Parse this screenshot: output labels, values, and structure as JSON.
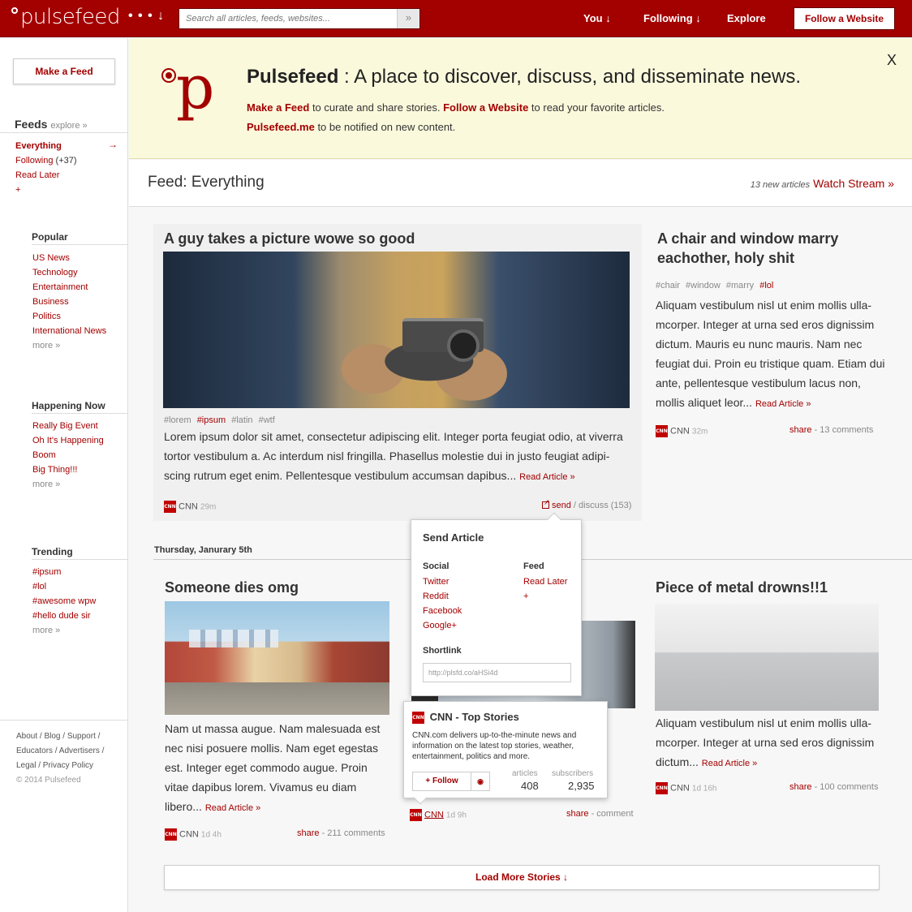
{
  "header": {
    "logo_text": "pulsefeed",
    "dots_label": "• • • ↓",
    "search_placeholder": "Search all articles, feeds, websites...",
    "search_button": "»",
    "nav": [
      "You ↓",
      "Following ↓",
      "Explore"
    ],
    "follow_website": "Follow a Website"
  },
  "sidebar": {
    "make_feed": "Make a Feed",
    "feeds_title": "Feeds",
    "feeds_explore": "explore »",
    "feeds": [
      {
        "label": "Everything"
      },
      {
        "label": "Following",
        "count": "(+37)"
      },
      {
        "label": "Read Later"
      },
      {
        "label": "+"
      }
    ],
    "arrow": "→",
    "popular_title": "Popular",
    "popular": [
      "US News",
      "Technology",
      "Entertainment",
      "Business",
      "Politics",
      "International News",
      "more »"
    ],
    "happening_title": "Happening Now",
    "happening": [
      "Really Big Event",
      "Oh It's Happening",
      "Boom",
      "Big Thing!!!",
      "more »"
    ],
    "trending_title": "Trending",
    "trending": [
      "#ipsum",
      "#lol",
      "#awesome wpw",
      "#hello dude sir",
      "more »"
    ],
    "footer": [
      "About / Blog / Support /",
      "Educators / Advertisers /",
      "Legal / Privacy Policy",
      "© 2014 Pulsefeed"
    ]
  },
  "banner": {
    "brand": "Pulsefeed",
    "tagline": " : A place to discover, discuss, and disseminate news.",
    "line1_a": "Make a Feed",
    "line1_b": " to curate and share stories.  ",
    "line1_c": "Follow a Website",
    "line1_d": " to read your favorite articles.",
    "line2_a": "Pulsefeed.me",
    "line2_b": " to be notified on new content.",
    "close": "X"
  },
  "feed": {
    "title": "Feed: Everything",
    "new_articles": "13 new articles",
    "watch_stream": "Watch Stream »"
  },
  "articles": {
    "featured": {
      "title": "A guy takes a picture wowe so good",
      "tags": [
        "#lorem",
        "#ipsum",
        "#latin",
        "#wtf"
      ],
      "body": "Lorem ipsum dolor sit amet, consectetur adipiscing elit. Integer porta feugiat odio, at viverra tortor vestibulum a. Ac interdum nisl fringilla. Phasellus molestie dui in justo feugiat adipi-scing rutrum eget enim. Pellentesque vestibulum accumsan dapibus... ",
      "read_more": "Read Article »",
      "source": "CNN",
      "time": "29m",
      "send": "send",
      "discuss": " / discuss (153)"
    },
    "chair": {
      "title": "A chair and window marry eachother, holy shit",
      "tags": [
        "#chair",
        "#window",
        "#marry",
        "#lol"
      ],
      "body": "Aliquam vestibulum nisl ut enim mollis ulla-mcorper. Integer at urna sed eros dignissim dictum. Mauris eu nunc mauris. Nam nec feugiat dui. Proin eu tristique quam. Etiam dui ante, pellentesque vestibulum lacus non, mollis aliquet leor... ",
      "read_more": "Read Article »",
      "source": "CNN",
      "time": "32m",
      "share": "share",
      "comments": " - 13 comments"
    },
    "date_label": "Thursday, Janurary 5th",
    "dies": {
      "title": "Someone dies omg",
      "body": "Nam ut massa augue. Nam malesuada est nec nisi posuere mollis. Nam eget egestas est. Integer eget commodo augue. Proin vitae dapibus lorem. Vivamus eu diam libero... ",
      "read_more": "Read Article »",
      "source": "CNN",
      "time": "1d 4h",
      "share": "share",
      "comments": " - 211 comments"
    },
    "middle": {
      "source": "CNN",
      "time": "1d 9h",
      "share": "share",
      "comments": " - comment"
    },
    "metal": {
      "title": "Piece of metal drowns!!1",
      "body": "Aliquam vestibulum nisl ut enim mollis ulla-mcorper. Integer at urna sed eros dignissim dictum... ",
      "read_more": "Read Article »",
      "source": "CNN",
      "time": "1d 16h",
      "share": "share",
      "comments": " - 100 comments"
    },
    "load_more": "Load More Stories ↓"
  },
  "send_popover": {
    "title": "Send Article",
    "social_title": "Social",
    "social": [
      "Twitter",
      "Reddit",
      "Facebook",
      "Google+"
    ],
    "feed_title": "Feed",
    "feed": [
      "Read Later",
      "+"
    ],
    "shortlink_title": "Shortlink",
    "shortlink_value": "http://plsfd.co/aHSi4d"
  },
  "source_card": {
    "name": "CNN - Top Stories",
    "description": "CNN.com delivers up-to-the-minute news and information on the latest top stories, weather, entertainment, politics and more.",
    "follow": "+ Follow",
    "articles_label": "articles",
    "articles_value": "408",
    "subscribers_label": "subscribers",
    "subscribers_value": "2,935"
  },
  "logo_label": "CNN",
  "colors": {
    "brand": "#a30000",
    "banner_bg": "#fbf9dc"
  }
}
